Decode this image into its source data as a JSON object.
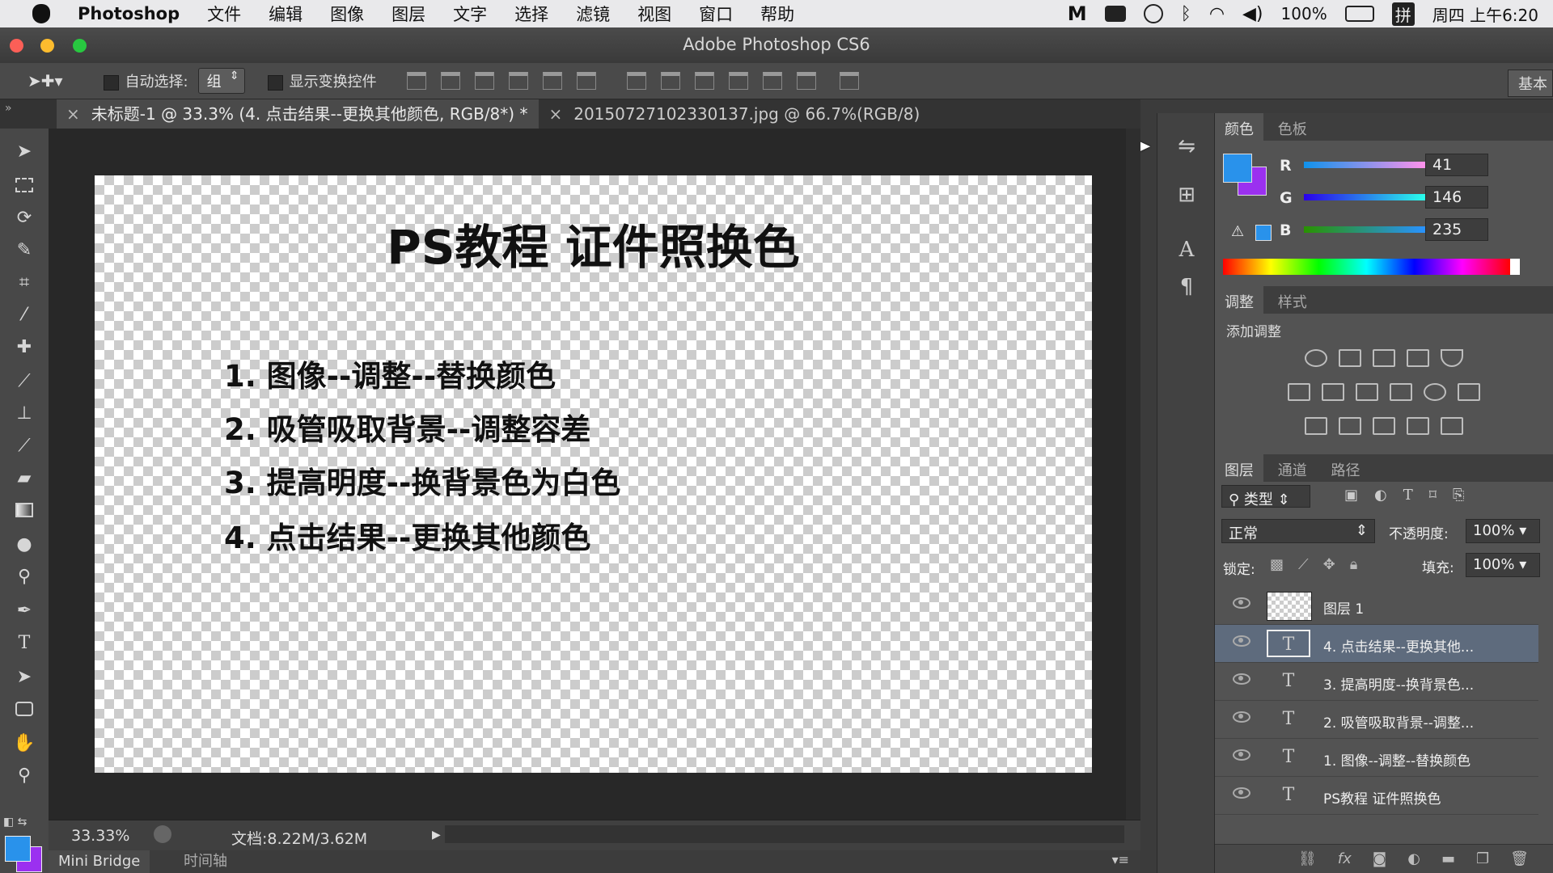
{
  "menubar": {
    "app_name": "Photoshop",
    "menus": [
      "文件",
      "编辑",
      "图像",
      "图层",
      "文字",
      "选择",
      "滤镜",
      "视图",
      "窗口",
      "帮助"
    ],
    "battery": "100%",
    "clock": "周四 上午6:20",
    "input_method": "拼"
  },
  "window": {
    "title": "Adobe Photoshop CS6"
  },
  "options": {
    "auto_select_label": "自动选择:",
    "auto_select_value": "组",
    "show_transform_label": "显示变换控件",
    "workspace_label": "基本"
  },
  "tabs": [
    {
      "label": "未标题-1 @ 33.3% (4. 点击结果--更换其他颜色, RGB/8*) *",
      "active": true
    },
    {
      "label": "20150727102330137.jpg @ 66.7%(RGB/8)",
      "active": false
    }
  ],
  "document": {
    "title": "PS教程 证件照换色",
    "steps": [
      "1. 图像--调整--替换颜色",
      "2. 吸管吸取背景--调整容差",
      "3. 提高明度--换背景色为白色",
      "4. 点击结果--更换其他颜色"
    ]
  },
  "status": {
    "zoom": "33.33%",
    "doc_size": "文档:8.22M/3.62M"
  },
  "bottom_tabs": [
    "Mini Bridge",
    "时间轴"
  ],
  "color_panel": {
    "tabs": [
      "颜色",
      "色板"
    ],
    "r_label": "R",
    "g_label": "G",
    "b_label": "B",
    "r": "41",
    "g": "146",
    "b": "235",
    "foreground": "#2992eb",
    "background": "#9b30f0"
  },
  "adjust_panel": {
    "tabs": [
      "调整",
      "样式"
    ],
    "add_label": "添加调整"
  },
  "layers_panel": {
    "tabs": [
      "图层",
      "通道",
      "路径"
    ],
    "filter": "类型",
    "blend_mode": "正常",
    "opacity_label": "不透明度:",
    "opacity": "100%",
    "lock_label": "锁定:",
    "fill_label": "填充:",
    "fill": "100%",
    "layers": [
      {
        "name": "图层 1",
        "type": "pixel"
      },
      {
        "name": "4. 点击结果--更换其他...",
        "type": "text",
        "selected": true
      },
      {
        "name": "3. 提高明度--换背景色...",
        "type": "text"
      },
      {
        "name": "2. 吸管吸取背景--调整...",
        "type": "text"
      },
      {
        "name": "1. 图像--调整--替换颜色",
        "type": "text"
      },
      {
        "name": "PS教程 证件照换色",
        "type": "text"
      }
    ]
  },
  "icons": {
    "apple": "apple-logo-icon",
    "move": "move-tool-icon",
    "marquee": "marquee-tool-icon",
    "lasso": "lasso-tool-icon",
    "type": "type-tool-icon",
    "eye": "eye-icon",
    "text_layer": "text-layer-icon"
  }
}
